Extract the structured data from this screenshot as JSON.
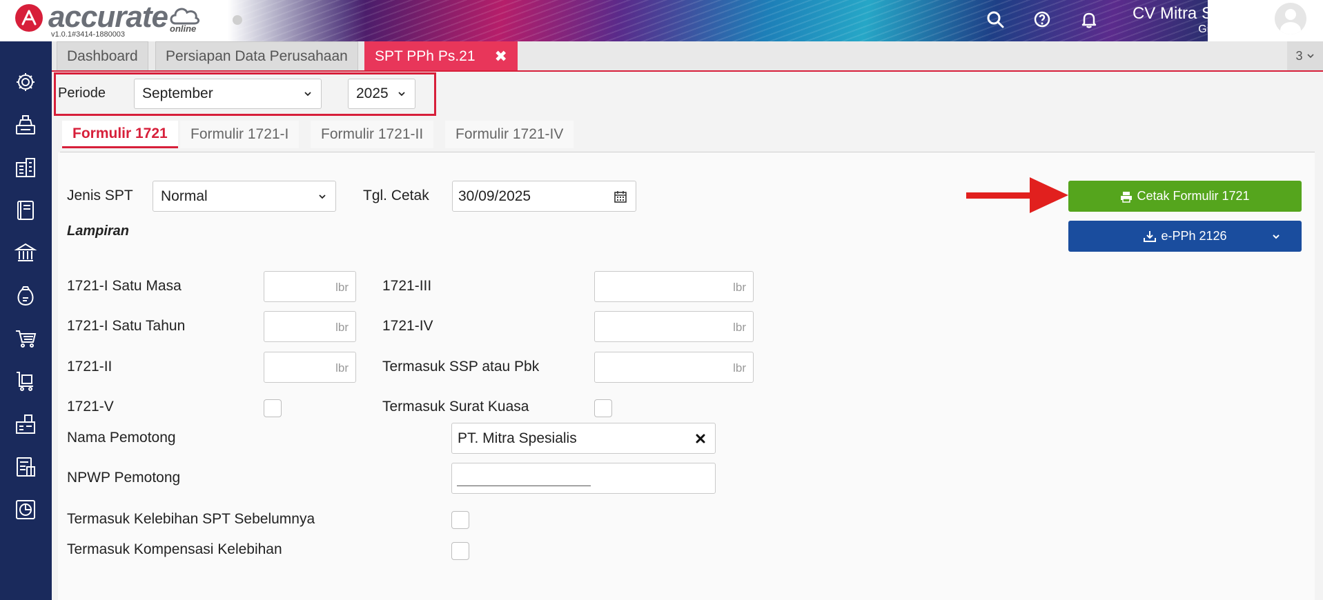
{
  "header": {
    "logo_text": "accurate",
    "logo_sub": "online",
    "version": "v1.0.1#3414-1880003",
    "company": "CV Mitra Spesialis",
    "user": "Gita Fauziah",
    "icons": [
      "search-icon",
      "help-icon",
      "bell-icon"
    ]
  },
  "sidebar": {
    "icons": [
      "gear-icon",
      "cash-register-icon",
      "building-icon",
      "book-icon",
      "bank-icon",
      "money-bag-icon",
      "cart-icon",
      "purchase-cart-icon",
      "warehouse-icon",
      "tax-icon",
      "report-chart-icon"
    ]
  },
  "tabs": [
    {
      "label": "Dashboard"
    },
    {
      "label": "Persiapan Data Perusahaan"
    },
    {
      "label": "SPT PPh Ps.21",
      "close": "✖"
    }
  ],
  "tab_counter": "3",
  "periode": {
    "label": "Periode",
    "month": "September",
    "year": "2025"
  },
  "form_tabs": [
    "Formulir 1721",
    "Formulir 1721-I",
    "Formulir 1721-II",
    "Formulir 1721-IV"
  ],
  "form": {
    "jenis_spt_label": "Jenis SPT",
    "jenis_spt_value": "Normal",
    "tgl_cetak_label": "Tgl. Cetak",
    "tgl_cetak_value": "30/09/2025",
    "lampiran_label": "Lampiran",
    "unit": "lbr",
    "left_fields": [
      "1721-I Satu Masa",
      "1721-I Satu Tahun",
      "1721-II"
    ],
    "right_fields": [
      "1721-III",
      "1721-IV",
      "Termasuk SSP atau Pbk"
    ],
    "v_label": "1721-V",
    "surat_kuasa_label": "Termasuk Surat Kuasa",
    "nama_pemotong_label": "Nama Pemotong",
    "nama_pemotong_value": "PT. Mitra Spesialis",
    "npwp_label": "NPWP Pemotong",
    "kelebihan_label": "Termasuk Kelebihan SPT Sebelumnya",
    "kompensasi_label": "Termasuk Kompensasi Kelebihan"
  },
  "buttons": {
    "cetak": "Cetak Formulir 1721",
    "epph": "e-PPh 2126"
  },
  "colors": {
    "accent": "#d71f3a",
    "active_tab": "#e8365a",
    "sidebar": "#1a2a5c",
    "green_button": "#55a51d",
    "blue_button": "#1a4d9e"
  }
}
